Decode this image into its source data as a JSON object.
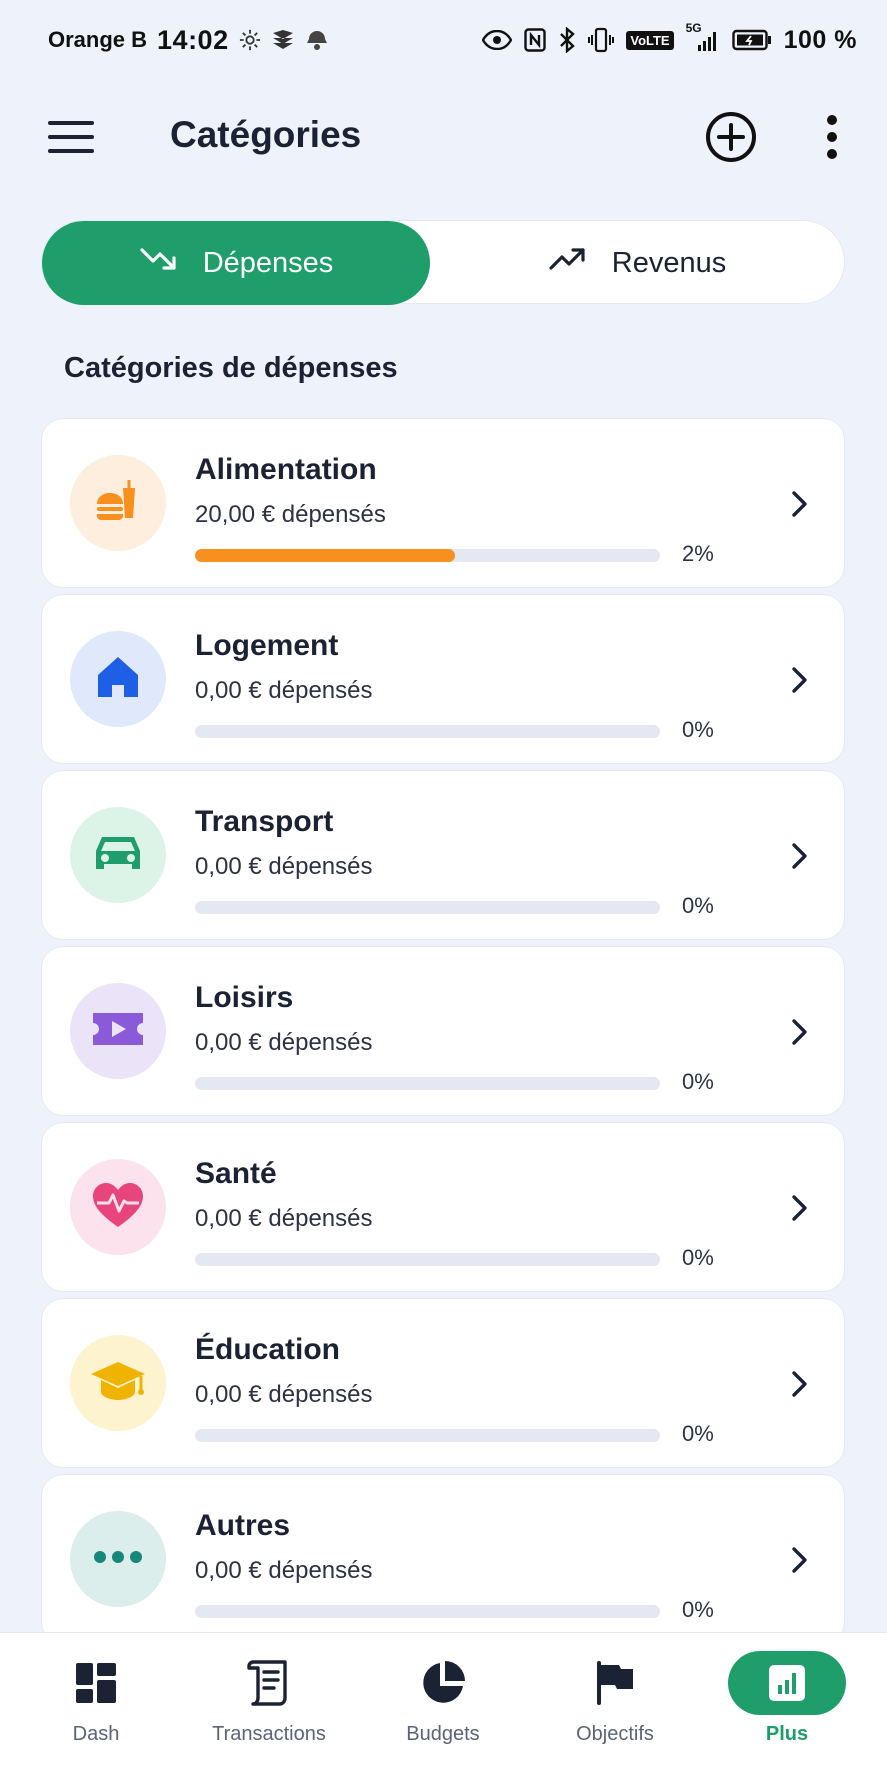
{
  "status_bar": {
    "carrier": "Orange B",
    "time": "14:02",
    "network": "5G",
    "volte": "VoLTE",
    "battery": "100 %"
  },
  "header": {
    "title": "Catégories"
  },
  "segment": {
    "expenses_label": "Dépenses",
    "income_label": "Revenus",
    "active": "expenses"
  },
  "section_title": "Catégories de dépenses",
  "categories": [
    {
      "name": "Alimentation",
      "spent": "20,00 € dépensés",
      "percent_label": "2%",
      "progress": 0.56,
      "icon": "food-icon",
      "color": "#f7901e",
      "bg": "#fdeede"
    },
    {
      "name": "Logement",
      "spent": "0,00 € dépensés",
      "percent_label": "0%",
      "progress": 0,
      "icon": "home-icon",
      "color": "#1e5fe6",
      "bg": "#dfe9fb"
    },
    {
      "name": "Transport",
      "spent": "0,00 € dépensés",
      "percent_label": "0%",
      "progress": 0,
      "icon": "car-icon",
      "color": "#1f9d6b",
      "bg": "#dcf3e8"
    },
    {
      "name": "Loisirs",
      "spent": "0,00 € dépensés",
      "percent_label": "0%",
      "progress": 0,
      "icon": "ticket-icon",
      "color": "#8a5ad8",
      "bg": "#ebe3f8"
    },
    {
      "name": "Santé",
      "spent": "0,00 € dépensés",
      "percent_label": "0%",
      "progress": 0,
      "icon": "heart-pulse-icon",
      "color": "#e8457c",
      "bg": "#fbe2ec"
    },
    {
      "name": "Éducation",
      "spent": "0,00 € dépensés",
      "percent_label": "0%",
      "progress": 0,
      "icon": "graduation-cap-icon",
      "color": "#f0b400",
      "bg": "#fdf3cf"
    },
    {
      "name": "Autres",
      "spent": "0,00 € dépensés",
      "percent_label": "0%",
      "progress": 0,
      "icon": "dots-icon",
      "color": "#16877a",
      "bg": "#dbeeeb"
    }
  ],
  "bottom_nav": [
    {
      "label": "Dash",
      "icon": "dashboard-icon"
    },
    {
      "label": "Transactions",
      "icon": "receipt-icon"
    },
    {
      "label": "Budgets",
      "icon": "pie-chart-icon"
    },
    {
      "label": "Objectifs",
      "icon": "flag-icon"
    },
    {
      "label": "Plus",
      "icon": "chart-bars-icon",
      "active": true
    }
  ],
  "colors": {
    "accent": "#1f9d6b",
    "background": "#eef3fb"
  }
}
